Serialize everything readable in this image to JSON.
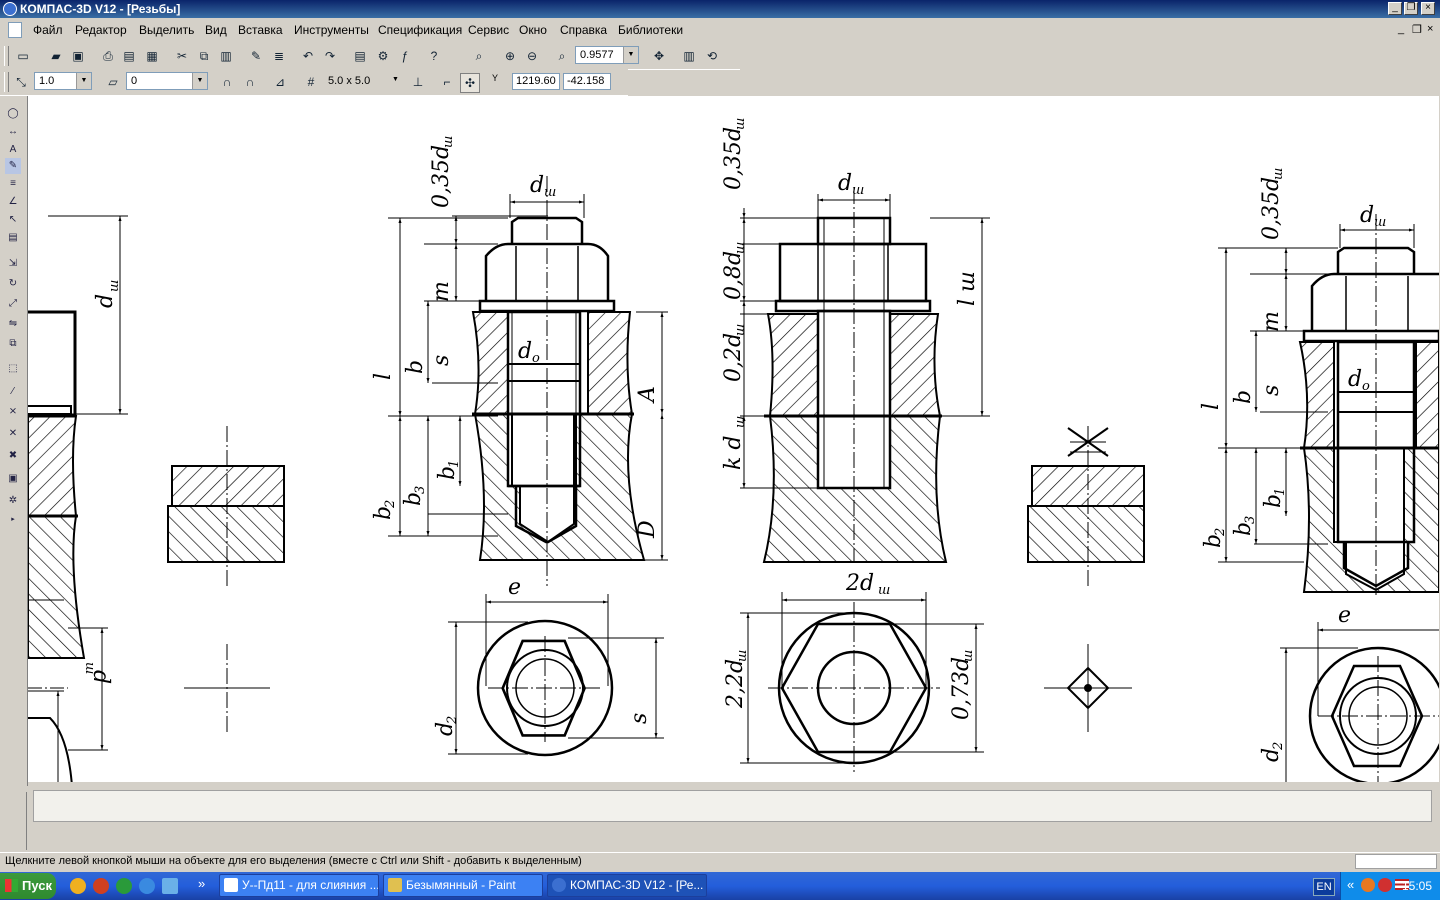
{
  "window": {
    "title": "КОМПАС-3D V12 - [Резьбы]"
  },
  "menu": [
    "Файл",
    "Редактор",
    "Выделить",
    "Вид",
    "Вставка",
    "Инструменты",
    "Спецификация",
    "Сервис",
    "Окно",
    "Справка",
    "Библиотеки"
  ],
  "toolbar": {
    "zoom_value": "0.9577",
    "line_scale": "1.0",
    "layer": "0",
    "grid_step": "5.0 x 5.0",
    "coord_x": "1219.60",
    "coord_y": "-42.158",
    "coord_label": "Y"
  },
  "drawing": {
    "labels": {
      "d_sh": "d",
      "sub_sh": "ш",
      "k035": "0,35d",
      "k08": "0,8d",
      "k02": "0,2d",
      "k2": "2d",
      "k22": "2,2d",
      "k073": "0,73d",
      "kd": "k d",
      "l": "l",
      "l_sh": "l ш",
      "b": "b",
      "m": "m",
      "s": "s",
      "A": "A",
      "D": "D",
      "b1": "b",
      "sub1": "1",
      "b2": "b",
      "sub2": "2",
      "b3": "b",
      "sub3": "3",
      "d0": "d",
      "sub0": "о",
      "e": "e",
      "d2": "d"
    }
  },
  "status": {
    "hint": "Щелкните левой кнопкой мыши на объекте для его выделения (вместе с Ctrl или Shift - добавить к выделенным)"
  },
  "taskbar": {
    "start": "Пуск",
    "tasks": [
      "У--Пд11 - для слияния ...",
      "Безымянный - Paint",
      "КОМПАС-3D V12 - [Ре..."
    ],
    "lang": "EN",
    "clock": "15:05"
  },
  "colors": {
    "accent": "#0a246a",
    "taskbar": "#245edb"
  }
}
